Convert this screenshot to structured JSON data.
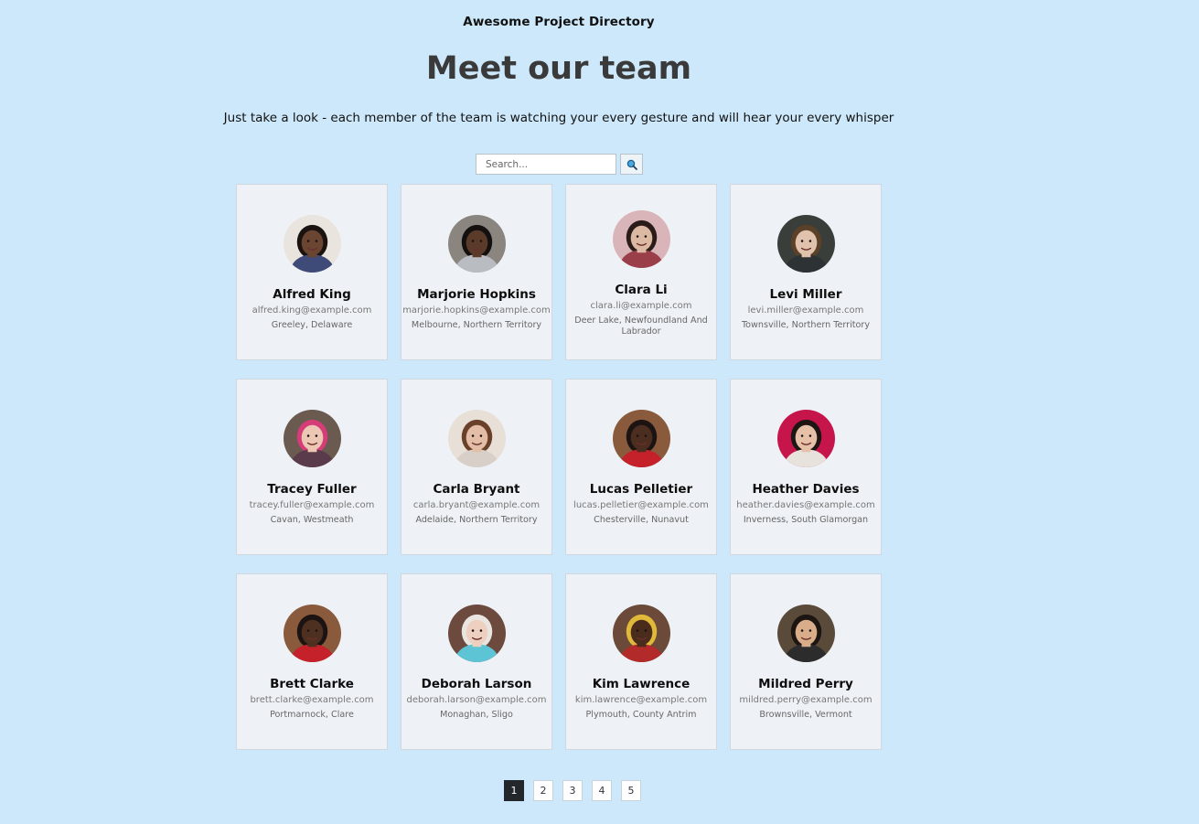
{
  "header": {
    "app_title": "Awesome Project Directory",
    "page_title": "Meet our team",
    "tagline": "Just take a look - each member of the team is watching your every gesture and will hear your every whisper"
  },
  "search": {
    "placeholder": "Search...",
    "value": "",
    "button_icon": "search-icon"
  },
  "members": [
    {
      "name": "Alfred King",
      "email": "alfred.king@example.com",
      "location": "Greeley, Delaware",
      "avatar": {
        "bg": "#e9e4dd",
        "skin": "#6a4532",
        "hair": "#1b130f",
        "shirt": "#3e4b78"
      }
    },
    {
      "name": "Marjorie Hopkins",
      "email": "marjorie.hopkins@example.com",
      "location": "Melbourne, Northern Territory",
      "avatar": {
        "bg": "#8b8580",
        "skin": "#5a3b2a",
        "hair": "#141010",
        "shirt": "#b9bcc0"
      }
    },
    {
      "name": "Clara Li",
      "email": "clara.li@example.com",
      "location": "Deer Lake, Newfoundland And Labrador",
      "avatar": {
        "bg": "#d9b4b8",
        "skin": "#dcb9a2",
        "hair": "#2a1c18",
        "shirt": "#9a3f4a"
      }
    },
    {
      "name": "Levi Miller",
      "email": "levi.miller@example.com",
      "location": "Townsville, Northern Territory",
      "avatar": {
        "bg": "#3a3e3a",
        "skin": "#e1c2ad",
        "hair": "#5b4128",
        "shirt": "#2d3335"
      }
    },
    {
      "name": "Tracey Fuller",
      "email": "tracey.fuller@example.com",
      "location": "Cavan, Westmeath",
      "avatar": {
        "bg": "#6b5a4f",
        "skin": "#ecc7b3",
        "hair": "#d63c78",
        "shirt": "#5a3b4b"
      }
    },
    {
      "name": "Carla Bryant",
      "email": "carla.bryant@example.com",
      "location": "Adelaide, Northern Territory",
      "avatar": {
        "bg": "#e8dfd7",
        "skin": "#e3bda5",
        "hair": "#6a4029",
        "shirt": "#d8d0c8"
      }
    },
    {
      "name": "Lucas Pelletier",
      "email": "lucas.pelletier@example.com",
      "location": "Chesterville, Nunavut",
      "avatar": {
        "bg": "#8a5a3c",
        "skin": "#4b2e1f",
        "hair": "#1c1412",
        "shirt": "#c4212b"
      }
    },
    {
      "name": "Heather Davies",
      "email": "heather.davies@example.com",
      "location": "Inverness, South Glamorgan",
      "avatar": {
        "bg": "#c6154b",
        "skin": "#e6c1a8",
        "hair": "#1d1614",
        "shirt": "#e8e2dc"
      }
    },
    {
      "name": "Brett Clarke",
      "email": "brett.clarke@example.com",
      "location": "Portmarnock, Clare",
      "avatar": {
        "bg": "#8a5a3c",
        "skin": "#4e3020",
        "hair": "#1c1412",
        "shirt": "#c4212b"
      }
    },
    {
      "name": "Deborah Larson",
      "email": "deborah.larson@example.com",
      "location": "Monaghan, Sligo",
      "avatar": {
        "bg": "#6d4a3e",
        "skin": "#edd0bf",
        "hair": "#e9e6e2",
        "shirt": "#5cc4d4"
      }
    },
    {
      "name": "Kim Lawrence",
      "email": "kim.lawrence@example.com",
      "location": "Plymouth, County Antrim",
      "avatar": {
        "bg": "#6b4a3a",
        "skin": "#4a2c1d",
        "hair": "#e0b93a",
        "shirt": "#b32a2a"
      }
    },
    {
      "name": "Mildred Perry",
      "email": "mildred.perry@example.com",
      "location": "Brownsville, Vermont",
      "avatar": {
        "bg": "#5a4a3a",
        "skin": "#d9ad8a",
        "hair": "#1c1512",
        "shirt": "#2c2c2c"
      }
    }
  ],
  "pagination": {
    "pages": [
      "1",
      "2",
      "3",
      "4",
      "5"
    ],
    "current": "1"
  }
}
